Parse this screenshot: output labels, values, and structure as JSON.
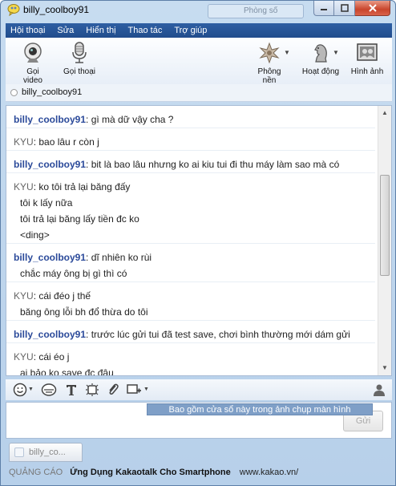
{
  "window": {
    "title": "billy_coolboy91",
    "background_tab_text": "Phòng số"
  },
  "menu": [
    "Hội thoại",
    "Sửa",
    "Hiển thị",
    "Thao tác",
    "Trợ giúp"
  ],
  "toolbar": {
    "video_call": "Gọi video",
    "voice_call": "Gọi thoại",
    "backgrounds": "Phông nền",
    "activities": "Hoạt động",
    "photos": "Hình ảnh"
  },
  "contact": {
    "name": "billy_coolboy91"
  },
  "messages": [
    {
      "sender": "billy_coolboy91",
      "lines": [
        "gì mà dữ vậy cha ?"
      ]
    },
    {
      "sender": "KYU",
      "lines": [
        "bao lâu r còn j"
      ]
    },
    {
      "sender": "billy_coolboy91",
      "lines": [
        "bit là bao lâu nhưng ko ai kiu tui đi thu máy làm sao mà có"
      ]
    },
    {
      "sender": "KYU",
      "lines": [
        "ko tôi trả lại băng đấy",
        "tôi k lấy nữa",
        "tôi trả lại băng lấy tiền đc ko",
        "<ding>"
      ]
    },
    {
      "sender": "billy_coolboy91",
      "lines": [
        "dĩ nhiên ko rùi",
        "chắc máy ông bị gì thì có"
      ]
    },
    {
      "sender": "KYU",
      "lines": [
        "cái đéo j thế",
        "băng ông lỗi bh đổ thừa do tôi"
      ]
    },
    {
      "sender": "billy_coolboy91",
      "lines": [
        "trước lúc gửi tui đã test save, chơi bình thường mới dám gửi"
      ]
    },
    {
      "sender": "KYU",
      "lines": [
        "cái éo j",
        "ai bảo ko save đc đâu"
      ]
    }
  ],
  "input": {
    "send_label": "Gửi",
    "tooltip": "Bao gồm cửa sổ này trong ảnh chụp màn hình"
  },
  "tab": {
    "label": "billy_co..."
  },
  "ad": {
    "label": "QUẢNG CÁO",
    "title": "Ứng Dụng Kakaotalk Cho Smartphone",
    "url": "www.kakao.vn/"
  }
}
